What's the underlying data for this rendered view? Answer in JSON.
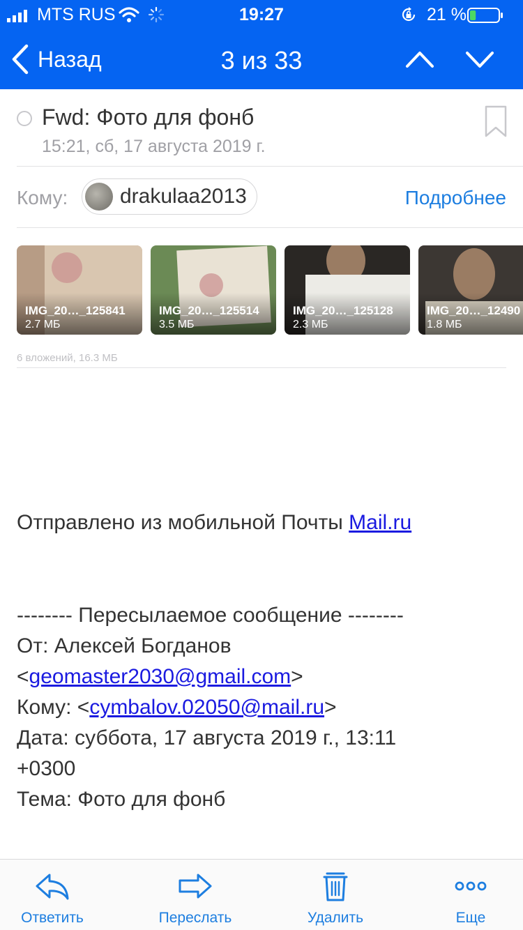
{
  "status_bar": {
    "carrier": "MTS RUS",
    "time": "19:27",
    "battery_percent": "21 %",
    "battery_level": 0.21,
    "signal_icon": "signal-bars-icon",
    "wifi_icon": "wifi-icon",
    "activity_icon": "activity-spinner-icon",
    "lock_icon": "rotation-lock-icon",
    "battery_icon": "battery-icon"
  },
  "nav": {
    "back_label": "Назад",
    "counter": "3 из 33"
  },
  "message": {
    "subject": "Fwd: Фото для фонб",
    "date": "15:21, сб, 17 августа 2019 г.",
    "to_label": "Кому:",
    "recipient": "drakulaa2013",
    "details_label": "Подробнее"
  },
  "attachments": {
    "items": [
      {
        "name": "IMG_20…_125841",
        "size": "2.7 МБ"
      },
      {
        "name": "IMG_20…_125514",
        "size": "3.5 МБ"
      },
      {
        "name": "IMG_20…_125128",
        "size": "2.3 МБ"
      },
      {
        "name": "IMG_20…_12490",
        "size": "1.8 МБ"
      }
    ],
    "summary": "6 вложений, 16.3 МБ"
  },
  "body": {
    "sent_from": "Отправлено из мобильной Почты ",
    "sent_from_link": "Mail.ru",
    "fwd_header": "-------- Пересылаемое сообщение --------",
    "from_line": "От: Алексей Богданов",
    "lt": "<",
    "gt": ">",
    "from_email": "geomaster2030@gmail.com",
    "to_prefix": "Кому: <",
    "to_email": "cymbalov.02050@mail.ru",
    "date_line": "Дата: суббота, 17 августа 2019 г., 13:11",
    "tz_line": "+0300",
    "subject_line": "Тема: Фото для фонб"
  },
  "toolbar": {
    "reply": "Ответить",
    "forward": "Переслать",
    "delete": "Удалить",
    "more": "Еще"
  },
  "colors": {
    "header_bg": "#0564f2",
    "link": "#1a1ae0",
    "accent": "#1d7ee0",
    "battery_fill": "#4cd964"
  }
}
